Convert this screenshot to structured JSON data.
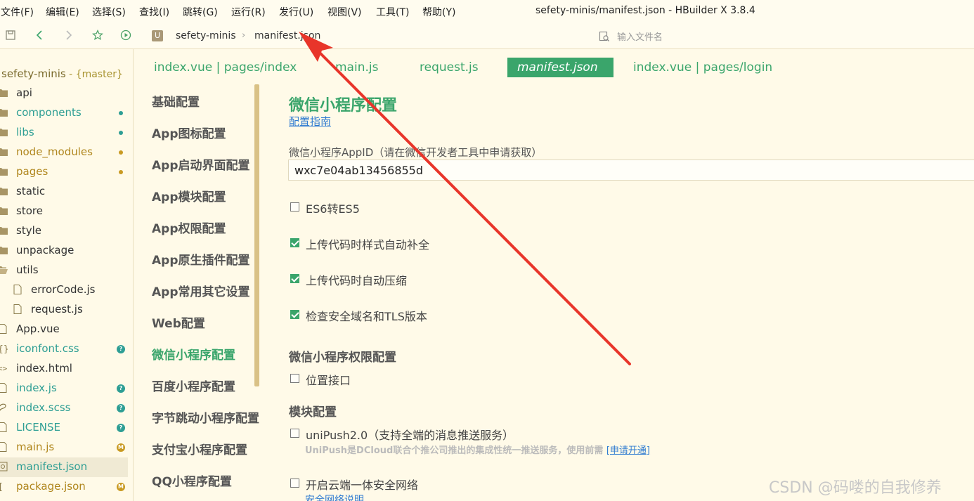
{
  "menubar": {
    "items": [
      "文件(F)",
      "编辑(E)",
      "选择(S)",
      "查找(I)",
      "跳转(G)",
      "运行(R)",
      "发行(U)",
      "视图(V)",
      "工具(T)",
      "帮助(Y)"
    ],
    "window_title": "sefety-minis/manifest.json - HBuilder X 3.8.4"
  },
  "toolbar": {
    "crumb_icon": "U",
    "breadcrumb": [
      "sefety-minis",
      "manifest.json"
    ],
    "file_search_placeholder": "输入文件名"
  },
  "sidebar": {
    "project_name": "sefety-minis",
    "branch": " - {master}",
    "items": [
      {
        "name": "api",
        "type": "folder",
        "color": "dark"
      },
      {
        "name": "components",
        "type": "folder",
        "color": "teal",
        "badge": "dot-teal"
      },
      {
        "name": "libs",
        "type": "folder",
        "color": "teal",
        "badge": "dot-teal"
      },
      {
        "name": "node_modules",
        "type": "folder",
        "color": "gold",
        "badge": "dot-gold"
      },
      {
        "name": "pages",
        "type": "folder",
        "color": "gold",
        "badge": "dot-gold"
      },
      {
        "name": "static",
        "type": "folder",
        "color": "dark"
      },
      {
        "name": "store",
        "type": "folder",
        "color": "dark"
      },
      {
        "name": "style",
        "type": "folder",
        "color": "dark"
      },
      {
        "name": "unpackage",
        "type": "folder",
        "color": "dark"
      },
      {
        "name": "utils",
        "type": "folder-open",
        "color": "dark"
      },
      {
        "name": "errorCode.js",
        "type": "file",
        "color": "dark",
        "indent": true
      },
      {
        "name": "request.js",
        "type": "file",
        "color": "dark",
        "indent": true
      },
      {
        "name": "App.vue",
        "type": "file",
        "color": "dark"
      },
      {
        "name": "iconfont.css",
        "type": "css",
        "color": "teal",
        "badge": "q"
      },
      {
        "name": "index.html",
        "type": "html",
        "color": "dark"
      },
      {
        "name": "index.js",
        "type": "file",
        "color": "teal",
        "badge": "q"
      },
      {
        "name": "index.scss",
        "type": "scss",
        "color": "teal",
        "badge": "q"
      },
      {
        "name": "LICENSE",
        "type": "file",
        "color": "teal",
        "badge": "q"
      },
      {
        "name": "main.js",
        "type": "file",
        "color": "gold",
        "badge": "M"
      },
      {
        "name": "manifest.json",
        "type": "json",
        "color": "teal",
        "selected": true
      },
      {
        "name": "package.json",
        "type": "json2",
        "color": "gold",
        "badge": "M"
      }
    ]
  },
  "tabs": [
    {
      "label": "index.vue | pages/index",
      "active": false
    },
    {
      "label": "main.js",
      "active": false
    },
    {
      "label": "request.js",
      "active": false
    },
    {
      "label": "manifest.json",
      "active": true
    },
    {
      "label": "index.vue | pages/login",
      "active": false
    }
  ],
  "settings_nav": [
    {
      "label": "基础配置",
      "active": false
    },
    {
      "label": "App图标配置",
      "active": false
    },
    {
      "label": "App启动界面配置",
      "active": false
    },
    {
      "label": "App模块配置",
      "active": false
    },
    {
      "label": "App权限配置",
      "active": false
    },
    {
      "label": "App原生插件配置",
      "active": false
    },
    {
      "label": "App常用其它设置",
      "active": false
    },
    {
      "label": "Web配置",
      "active": false
    },
    {
      "label": "微信小程序配置",
      "active": true
    },
    {
      "label": "百度小程序配置",
      "active": false
    },
    {
      "label": "字节跳动小程序配置",
      "active": false
    },
    {
      "label": "支付宝小程序配置",
      "active": false
    },
    {
      "label": "QQ小程序配置",
      "active": false
    }
  ],
  "content": {
    "title": "微信小程序配置",
    "guide_link": "配置指南",
    "appid_label": "微信小程序AppID（请在微信开发者工具中申请获取）",
    "appid_value": "wxc7e04ab13456855d",
    "options": [
      {
        "label": "ES6转ES5",
        "checked": false
      },
      {
        "label": "上传代码时样式自动补全",
        "checked": true
      },
      {
        "label": "上传代码时自动压缩",
        "checked": true
      },
      {
        "label": "检查安全域名和TLS版本",
        "checked": true
      }
    ],
    "permission_title": "微信小程序权限配置",
    "permission_option": {
      "label": "位置接口",
      "checked": false
    },
    "module_title": "模块配置",
    "unipush": {
      "label": "uniPush2.0（支持全端的消息推送服务）",
      "checked": false
    },
    "unipush_note": "UniPush是DCloud联合个推公司推出的集成性统一推送服务，使用前需 ",
    "unipush_link": "[申请开通]",
    "cloud": {
      "label": "开启云端一体安全网络",
      "checked": false
    },
    "cloud_link": "安全网络说明"
  },
  "watermark": "CSDN @码喽的自我修养",
  "colors": {
    "accent": "#3aa56b",
    "background": "#fffae8",
    "arrow": "#e8352a"
  }
}
